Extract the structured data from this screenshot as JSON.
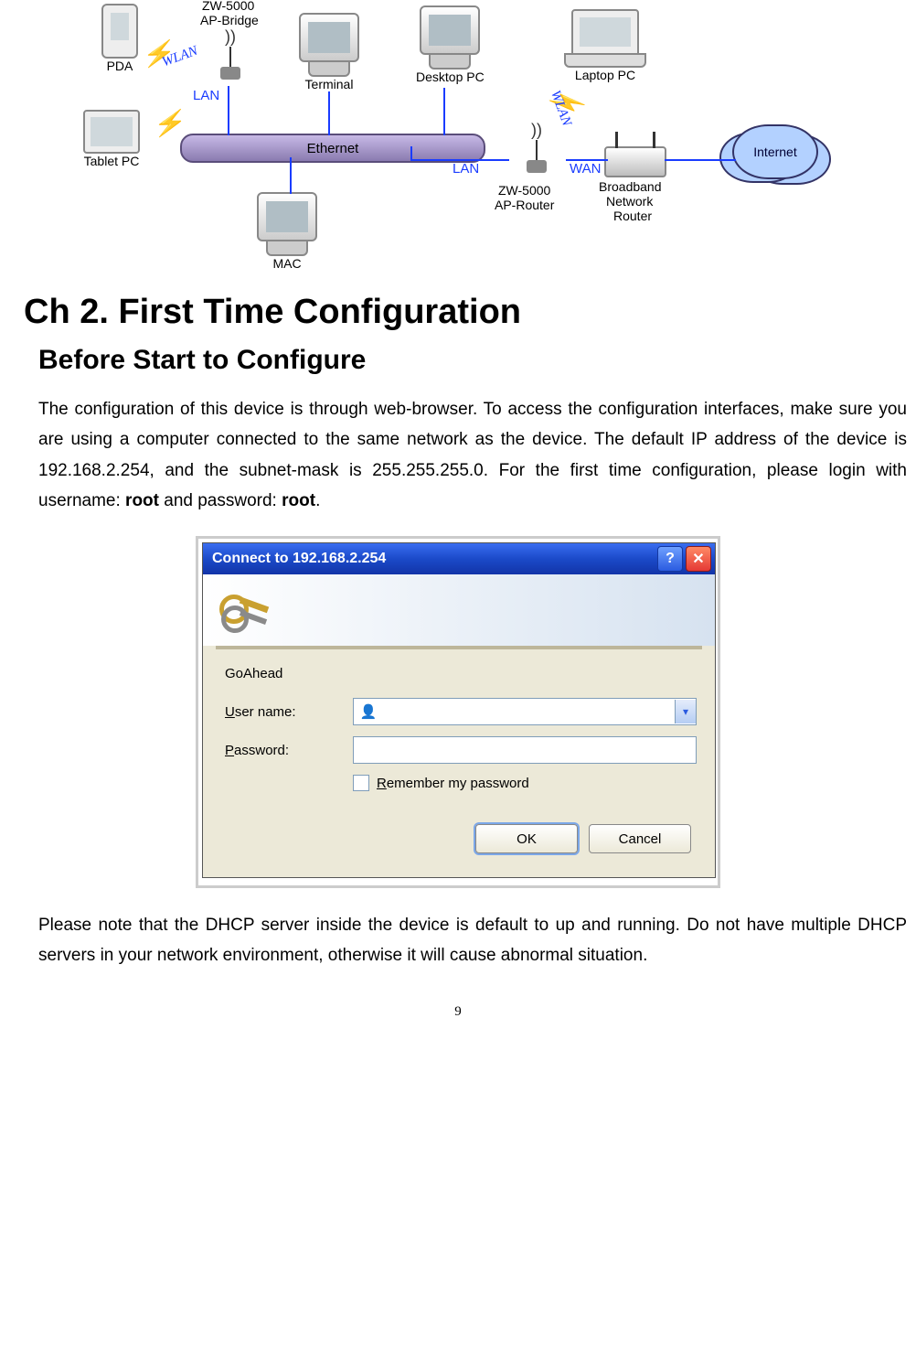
{
  "diagram": {
    "pda": "PDA",
    "tablet": "Tablet PC",
    "ap_bridge_top": "ZW-5000",
    "ap_bridge_bottom": "AP-Bridge",
    "terminal": "Terminal",
    "desktop": "Desktop PC",
    "laptop": "Laptop PC",
    "mac": "MAC",
    "ethernet": "Ethernet",
    "ap_router_top": "ZW-5000",
    "ap_router_bottom": "AP-Router",
    "broadband1": "Broadband",
    "broadband2": "Network",
    "broadband3": "Router",
    "internet": "Internet",
    "lan": "LAN",
    "wan": "WAN",
    "wlan": "WLAN"
  },
  "chapter_title": "Ch 2. First Time Configuration",
  "section_title": "Before Start to Configure",
  "para1_a": "The configuration of this device is through web-browser. To access the configuration interfaces, make sure you are using a computer connected to the same network as the device. The default IP address of the device is 192.168.2.254, and the subnet-mask is 255.255.255.0. For the first time configuration, please login with username: ",
  "para1_b": "root",
  "para1_c": " and password: ",
  "para1_d": "root",
  "para1_e": ".",
  "dialog": {
    "title": "Connect to 192.168.2.254",
    "realm": "GoAhead",
    "username_value": "",
    "ok": "OK",
    "cancel": "Cancel"
  },
  "para2": "Please note that the DHCP server inside the device is default to up and running. Do not have multiple DHCP servers in your network environment, otherwise it will cause abnormal situation.",
  "page_number": "9"
}
